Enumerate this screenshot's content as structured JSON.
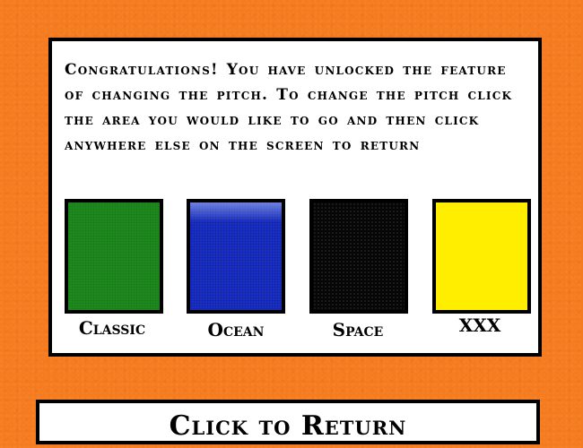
{
  "message": {
    "text": "Congratulations! You have unlocked the feature of changing the pitch. To change the pitch click the area you would like to go and then click anywhere else on the screen to return"
  },
  "pitches": [
    {
      "label": "Classic",
      "color": "#1e8a1e"
    },
    {
      "label": "Ocean",
      "color": "#1a2fc4"
    },
    {
      "label": "Space",
      "color": "#060606"
    },
    {
      "label": "XXX",
      "color": "#ffee00"
    }
  ],
  "return_button": {
    "label": "Click to Return"
  },
  "colors": {
    "background": "#f47b20",
    "panel": "#ffffff",
    "border": "#000000"
  }
}
